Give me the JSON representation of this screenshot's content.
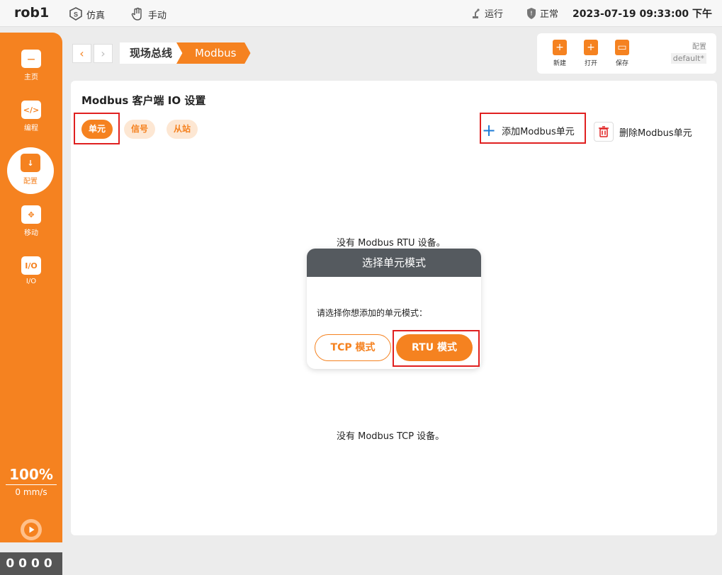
{
  "topbar": {
    "robot_name": "rob1",
    "sim_label": "仿真",
    "manual_label": "手动",
    "run_label": "运行",
    "status_label": "正常",
    "datetime": "2023-07-19 09:33:00 下午"
  },
  "sidebar": {
    "items": [
      {
        "label": "主页",
        "icon": "home-icon"
      },
      {
        "label": "编程",
        "icon": "code-icon"
      },
      {
        "label": "配置",
        "icon": "config-icon"
      },
      {
        "label": "移动",
        "icon": "move-icon"
      },
      {
        "label": "I/O",
        "icon": "io-icon"
      }
    ],
    "speed_pct": "100%",
    "speed_value": "0",
    "speed_unit": "mm/s",
    "counter": "0000"
  },
  "breadcrumb": {
    "items": [
      "现场总线",
      "Modbus"
    ]
  },
  "file_toolbar": {
    "new_label": "新建",
    "open_label": "打开",
    "save_label": "保存",
    "config_label": "配置",
    "config_value": "default*"
  },
  "main": {
    "title": "Modbus 客户端 IO 设置",
    "tabs": [
      "单元",
      "信号",
      "从站"
    ],
    "add_unit_label": "添加Modbus单元",
    "delete_unit_label": "删除Modbus单元",
    "rtu_empty_msg": "没有 Modbus RTU 设备。",
    "tcp_empty_msg": "没有 Modbus TCP 设备。"
  },
  "dialog": {
    "title": "选择单元模式",
    "prompt": "请选择你想添加的单元模式：",
    "tcp_button": "TCP 模式",
    "rtu_button": "RTU 模式"
  },
  "colors": {
    "accent": "#f58220",
    "highlight_border": "#e02020",
    "dialog_header": "#555a5f"
  }
}
